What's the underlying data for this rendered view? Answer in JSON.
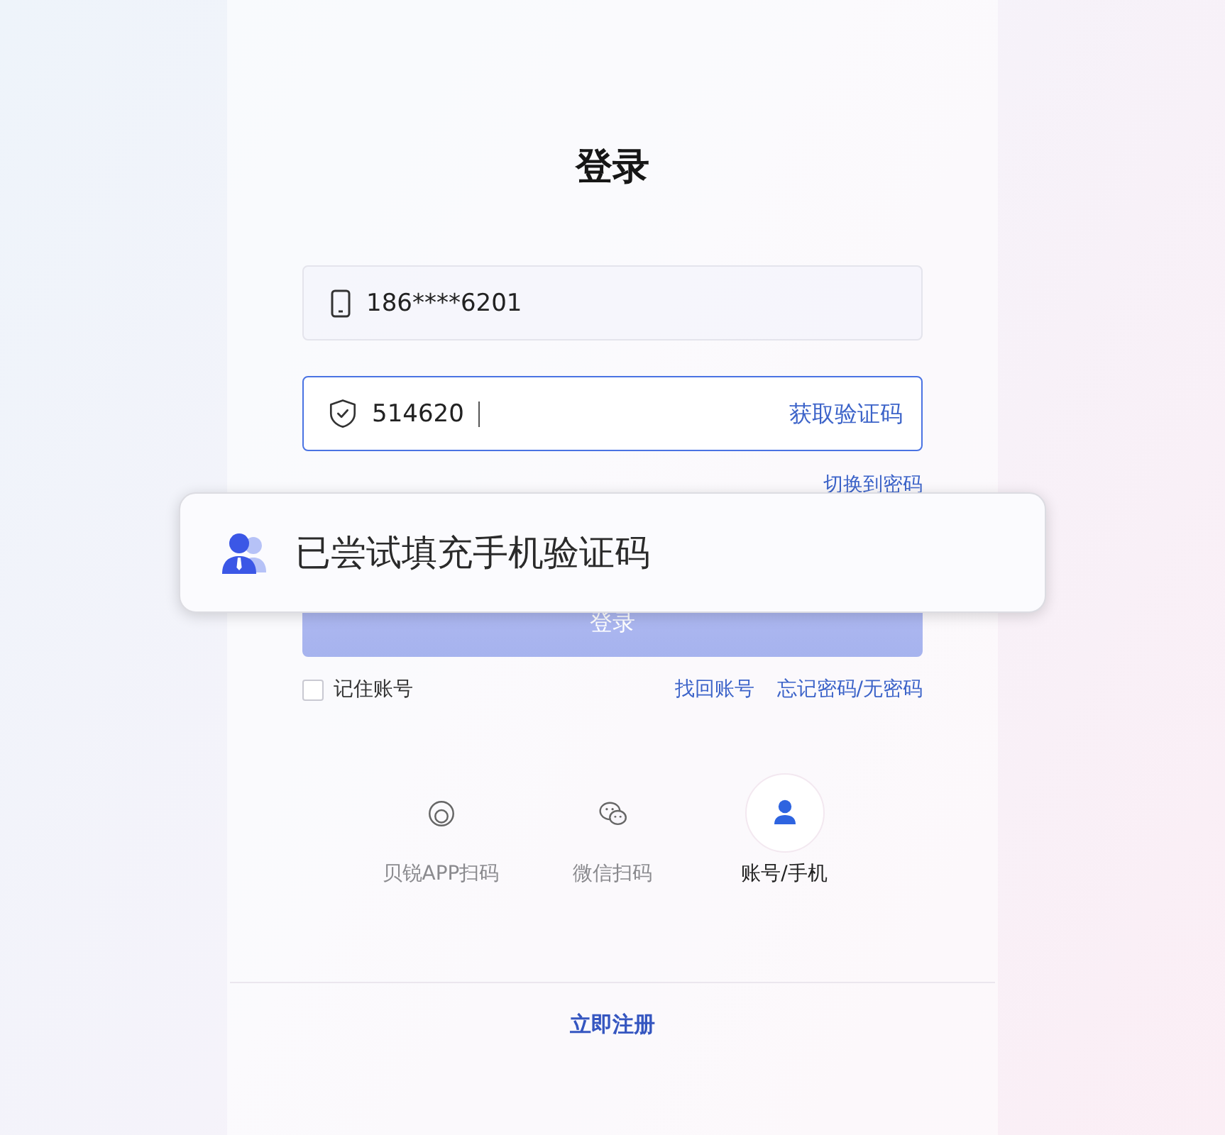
{
  "title": "登录",
  "fields": [
    {
      "kind": "phone",
      "value": "186****6201",
      "focused": false
    },
    {
      "kind": "code",
      "value": "514620",
      "focused": true,
      "action": "获取验证码"
    }
  ],
  "switch_link": "切换到密码",
  "login_button": {
    "label": "登录"
  },
  "remember": {
    "label": "记住账号",
    "checked": false
  },
  "links": [
    "找回账号",
    "忘记密码/无密码"
  ],
  "methods": [
    {
      "kind": "app",
      "label": "贝锐APP扫码",
      "selected": false
    },
    {
      "kind": "wechat",
      "label": "微信扫码",
      "selected": false
    },
    {
      "kind": "account",
      "label": "账号/手机",
      "selected": true
    }
  ],
  "register": "立即注册",
  "toast": {
    "message": "已尝试填充手机验证码"
  }
}
